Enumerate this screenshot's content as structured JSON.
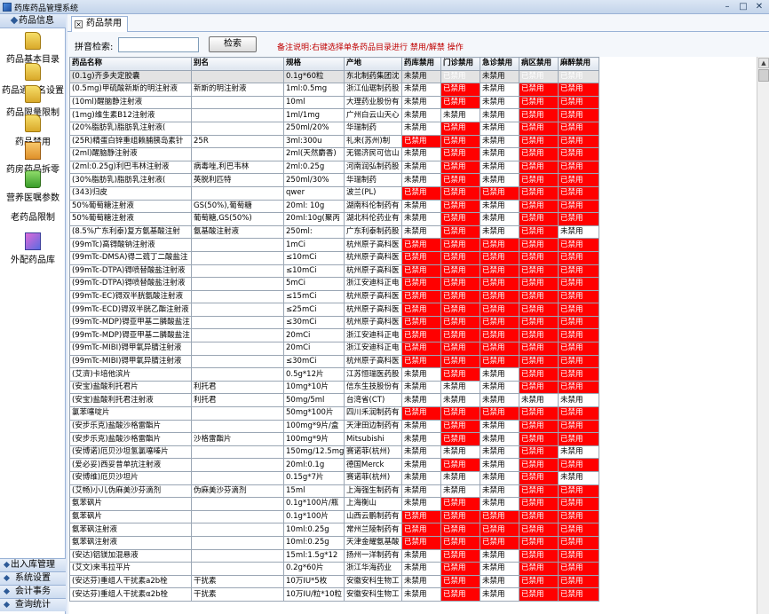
{
  "window": {
    "title": "药库药品管理系统"
  },
  "sidebar": {
    "header": "药品信息",
    "items": [
      {
        "label": "药品基本目录",
        "icon": "folder-icon"
      },
      {
        "label": "药品通用名设置",
        "icon": "folder-icon"
      },
      {
        "label": "药品限量限制",
        "icon": "folder-icon"
      },
      {
        "label": "药品禁用",
        "icon": "folder-icon"
      },
      {
        "label": "药房药品拆零",
        "icon": "box-icon"
      },
      {
        "label": "营养医嘱参数",
        "icon": "green-box-icon"
      },
      {
        "label": "老药品限制",
        "icon": "none"
      },
      {
        "label": "外配药品库",
        "icon": "stack-icon"
      }
    ],
    "bottom": [
      "出入库管理",
      "系统设置",
      "会计事务",
      "查询统计"
    ]
  },
  "tab": {
    "label": "药品禁用"
  },
  "search": {
    "label": "拼音检索:",
    "value": "",
    "button": "检索",
    "note": "备注说明:右键选择单条药品目录进行 禁用/解禁 操作"
  },
  "colors": {
    "banned": "#ff0000",
    "header": "#dde4ee"
  },
  "table": {
    "headers": [
      "药品名称",
      "别名",
      "规格",
      "产地",
      "药库禁用",
      "门诊禁用",
      "急诊禁用",
      "病区禁用",
      "麻醉禁用"
    ],
    "rows": [
      [
        "(0.1g)齐多夫定胶囊",
        "",
        "0.1g*60粒",
        "东北制药集团沈",
        "未禁用",
        "已禁用",
        "未禁用",
        "已禁用",
        "已禁用"
      ],
      [
        "(0.5mg)甲硫酸新斯的明注射液",
        "新斯的明注射液",
        "1ml:0.5mg",
        "浙江仙琚制药股",
        "未禁用",
        "已禁用",
        "未禁用",
        "已禁用",
        "已禁用"
      ],
      [
        "(10ml)醒脑静注射液",
        "",
        "10ml",
        "大理药业股份有",
        "未禁用",
        "已禁用",
        "未禁用",
        "已禁用",
        "已禁用"
      ],
      [
        "(1mg)维生素B12注射液",
        "",
        "1ml/1mg",
        "广州白云山天心",
        "未禁用",
        "未禁用",
        "未禁用",
        "已禁用",
        "已禁用"
      ],
      [
        "(20%脂肪乳)脂肪乳注射液(",
        "",
        "250ml/20%",
        "华瑞制药",
        "未禁用",
        "已禁用",
        "未禁用",
        "已禁用",
        "已禁用"
      ],
      [
        "(25R)精蛋白锌重组赖脯胰岛素针",
        "25R",
        "3ml:300u",
        "礼来(苏州)制",
        "已禁用",
        "已禁用",
        "未禁用",
        "已禁用",
        "已禁用"
      ],
      [
        "(2ml)醒脑静注射液",
        "",
        "2ml(天然麝香)",
        "无锡济民可信山",
        "未禁用",
        "已禁用",
        "未禁用",
        "已禁用",
        "已禁用"
      ],
      [
        "(2ml:0.25g)利巴韦林注射液",
        "病毒唑,利巴韦林",
        "2ml:0.25g",
        "河南润弘制药股",
        "未禁用",
        "已禁用",
        "未禁用",
        "已禁用",
        "已禁用"
      ],
      [
        "(30%脂肪乳)脂肪乳注射液(",
        "英脱利匹特",
        "250ml/30%",
        "华瑞制药",
        "未禁用",
        "已禁用",
        "未禁用",
        "已禁用",
        "已禁用"
      ],
      [
        "(343)归皮",
        "",
        "qwer",
        "波兰(PL)",
        "已禁用",
        "已禁用",
        "已禁用",
        "已禁用",
        "已禁用"
      ],
      [
        "50%葡萄糖注射液",
        "GS(50%),葡萄糖",
        "20ml: 10g",
        "湖南科伦制药有",
        "未禁用",
        "已禁用",
        "未禁用",
        "已禁用",
        "已禁用"
      ],
      [
        "50%葡萄糖注射液",
        "葡萄糖,GS(50%)",
        "20ml:10g(聚丙",
        "湖北科伦药业有",
        "未禁用",
        "已禁用",
        "未禁用",
        "已禁用",
        "已禁用"
      ],
      [
        "(8.5%广东利泰)复方氨基酸注射",
        "氨基酸注射液",
        "250ml:",
        "广东利泰制药股",
        "未禁用",
        "已禁用",
        "未禁用",
        "已禁用",
        "未禁用"
      ],
      [
        "(99mTc)高锝酸钠注射液",
        "",
        "1mCi",
        "杭州原子高科医",
        "已禁用",
        "已禁用",
        "已禁用",
        "已禁用",
        "已禁用"
      ],
      [
        "(99mTc-DMSA)得二巯丁二酸盐注",
        "",
        "≤10mCi",
        "杭州原子高科医",
        "已禁用",
        "已禁用",
        "已禁用",
        "已禁用",
        "已禁用"
      ],
      [
        "(99mTc-DTPA)锝喷替酸盐注射液",
        "",
        "≤10mCi",
        "杭州原子高科医",
        "已禁用",
        "已禁用",
        "已禁用",
        "已禁用",
        "已禁用"
      ],
      [
        "(99mTc-DTPA)锝喷替酸盐注射液",
        "",
        "5mCi",
        "浙江安迪科正电",
        "已禁用",
        "已禁用",
        "已禁用",
        "已禁用",
        "已禁用"
      ],
      [
        "(99mTc-EC)锝双半胱氨酸注射液",
        "",
        "≤15mCi",
        "杭州原子高科医",
        "已禁用",
        "已禁用",
        "已禁用",
        "已禁用",
        "已禁用"
      ],
      [
        "(99mTc-ECD)锝双半胱乙酯注射液",
        "",
        "≤25mCi",
        "杭州原子高科医",
        "已禁用",
        "已禁用",
        "已禁用",
        "已禁用",
        "已禁用"
      ],
      [
        "(99mTc-MDP)锝亚甲基二膦酸盐注",
        "",
        "≤30mCi",
        "杭州原子高科医",
        "已禁用",
        "已禁用",
        "已禁用",
        "已禁用",
        "已禁用"
      ],
      [
        "(99mTc-MDP)锝亚甲基二膦酸盐注",
        "",
        "20mCi",
        "浙江安迪科正电",
        "已禁用",
        "已禁用",
        "已禁用",
        "已禁用",
        "已禁用"
      ],
      [
        "(99mTc-MIBI)锝甲氧异腈注射液",
        "",
        "20mCi",
        "浙江安迪科正电",
        "已禁用",
        "已禁用",
        "已禁用",
        "已禁用",
        "已禁用"
      ],
      [
        "(99mTc-MIBI)锝甲氧异腈注射液",
        "",
        "≤30mCi",
        "杭州原子高科医",
        "已禁用",
        "已禁用",
        "已禁用",
        "已禁用",
        "已禁用"
      ],
      [
        "(艾濟)卡培他滨片",
        "",
        "0.5g*12片",
        "江苏恒瑞医药股",
        "未禁用",
        "已禁用",
        "未禁用",
        "已禁用",
        "已禁用"
      ],
      [
        "(安宝)盐酸利托君片",
        "利托君",
        "10mg*10片",
        "信东生技股份有",
        "未禁用",
        "未禁用",
        "未禁用",
        "已禁用",
        "已禁用"
      ],
      [
        "(安宝)盐酸利托君注射液",
        "利托君",
        "50mg/5ml",
        "台湾省(CT)",
        "未禁用",
        "未禁用",
        "未禁用",
        "未禁用",
        "未禁用"
      ],
      [
        "氯苯噻啶片",
        "",
        "50mg*100片",
        "四川禾润制药有",
        "已禁用",
        "已禁用",
        "已禁用",
        "已禁用",
        "已禁用"
      ],
      [
        "(安步乐克)盐酸沙格雷酯片",
        "",
        "100mg*9片/盒",
        "天津田边制药有",
        "未禁用",
        "已禁用",
        "未禁用",
        "已禁用",
        "已禁用"
      ],
      [
        "(安步乐克)盐酸沙格雷酯片",
        "沙格雷酯片",
        "100mg*9片",
        "Mitsubishi",
        "未禁用",
        "已禁用",
        "未禁用",
        "已禁用",
        "已禁用"
      ],
      [
        "(安博诺)厄贝沙坦氢氯噻嗪片",
        "",
        "150mg/12.5mg*",
        "赛诺菲(杭州)",
        "未禁用",
        "未禁用",
        "未禁用",
        "已禁用",
        "未禁用"
      ],
      [
        "(爱必妥)西妥昔单抗注射液",
        "",
        "20ml:0.1g",
        "德国Merck",
        "未禁用",
        "已禁用",
        "未禁用",
        "已禁用",
        "已禁用"
      ],
      [
        "(安博维)厄贝沙坦片",
        "",
        "0.15g*7片",
        "赛诺菲(杭州)",
        "未禁用",
        "未禁用",
        "未禁用",
        "已禁用",
        "未禁用"
      ],
      [
        "(艾畅)小儿伪麻美沙芬滴剂",
        "伪麻美沙芬滴剂",
        "15ml",
        "上海强生制药有",
        "未禁用",
        "未禁用",
        "未禁用",
        "已禁用",
        "已禁用"
      ],
      [
        "氨苯砜片",
        "",
        "0.1g*100片/瓶",
        "上海衡山",
        "未禁用",
        "已禁用",
        "未禁用",
        "已禁用",
        "已禁用"
      ],
      [
        "氨苯砜片",
        "",
        "0.1g*100片",
        "山西云鹏制药有",
        "已禁用",
        "已禁用",
        "已禁用",
        "已禁用",
        "已禁用"
      ],
      [
        "氨苯砜注射液",
        "",
        "10ml:0.25g",
        "常州兰陵制药有",
        "已禁用",
        "已禁用",
        "已禁用",
        "已禁用",
        "已禁用"
      ],
      [
        "氨苯砜注射液",
        "",
        "10ml:0.25g",
        "天津金耀氨基酸",
        "已禁用",
        "已禁用",
        "已禁用",
        "已禁用",
        "已禁用"
      ],
      [
        "(安达)铝镁加混悬液",
        "",
        "15ml:1.5g*12",
        "扬州一洋制药有",
        "未禁用",
        "已禁用",
        "未禁用",
        "已禁用",
        "已禁用"
      ],
      [
        "(艾文)来韦拉平片",
        "",
        "0.2g*60片",
        "浙江华海药业",
        "未禁用",
        "已禁用",
        "未禁用",
        "已禁用",
        "已禁用"
      ],
      [
        "(安达芬)重组人干扰素a2b栓",
        "干扰素",
        "10万IU*5枚",
        "安徽安科生物工",
        "未禁用",
        "已禁用",
        "未禁用",
        "已禁用",
        "已禁用"
      ],
      [
        "(安达芬)重组人干扰素α2b栓",
        "干扰素",
        "10万IU/粒*10粒",
        "安徽安科生物工",
        "未禁用",
        "已禁用",
        "未禁用",
        "已禁用",
        "已禁用"
      ]
    ]
  }
}
